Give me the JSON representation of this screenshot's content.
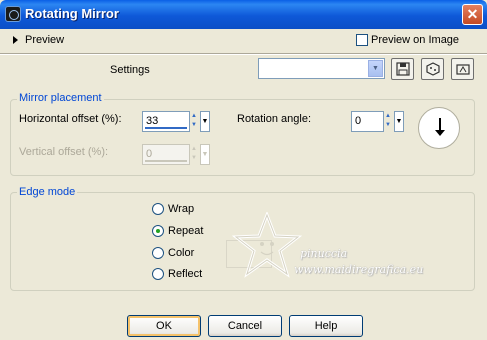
{
  "window": {
    "title": "Rotating Mirror",
    "close_glyph": "✕"
  },
  "preview": {
    "label": "Preview",
    "on_image_label": "Preview on Image",
    "on_image_checked": false
  },
  "settings": {
    "label": "Settings",
    "value": ""
  },
  "mirror": {
    "legend": "Mirror placement",
    "h_offset_label": "Horizontal offset (%):",
    "h_offset_value": "33",
    "v_offset_label": "Vertical offset (%):",
    "v_offset_value": "0",
    "rotation_label": "Rotation angle:",
    "rotation_value": "0"
  },
  "edge": {
    "legend": "Edge mode",
    "options": [
      "Wrap",
      "Repeat",
      "Color",
      "Reflect"
    ],
    "selected": "Repeat"
  },
  "watermark": {
    "line1": "pinuccia",
    "line2": "www.maidiregrafica.eu"
  },
  "buttons": {
    "ok": "OK",
    "cancel": "Cancel",
    "help": "Help"
  },
  "colors": {
    "title_bar": "#0b4fc6",
    "dialog_bg": "#ece9d8",
    "legend_text": "#0046d5",
    "radio_selected": "#21a121"
  },
  "icons": {
    "save": "save-preset-icon",
    "reset": "reset-icon",
    "randomize": "randomize-icon",
    "app": "app-icon",
    "close": "close-icon"
  }
}
